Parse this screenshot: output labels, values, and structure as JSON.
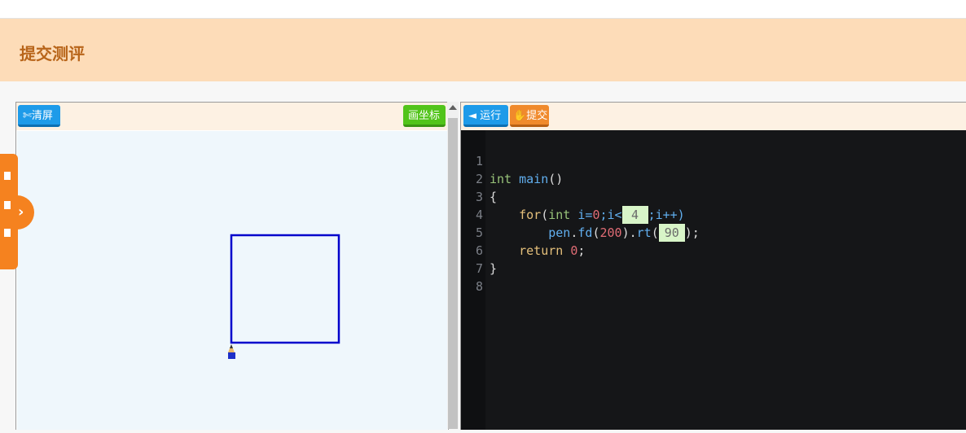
{
  "header": {
    "title": "提交测评"
  },
  "left_toolbar": {
    "clear_label": "清屏",
    "clear_icon": "scissors-icon",
    "coord_label": "画坐标"
  },
  "right_toolbar": {
    "run_label": "运行",
    "run_icon": "play-left-icon",
    "submit_label": "提交",
    "submit_icon": "hand-icon"
  },
  "drawing": {
    "shape": "square",
    "stroke_color": "#0000cc",
    "pen_icon": "pencil-icon"
  },
  "code": {
    "line_numbers": [
      "1",
      "2",
      "3",
      "4",
      "5",
      "6",
      "7",
      "8"
    ],
    "line1_type": "int",
    "line1_fn": "main",
    "line1_parens": "()",
    "line2": "{",
    "line3_for": "for",
    "line3_open": "(",
    "line3_int": "int",
    "line3_var": " i=",
    "line3_zero": "0",
    "line3_cond": ";i<",
    "blank1_value": "4",
    "line3_end": ";i++)",
    "line4_obj": "pen",
    "line4_dot1": ".",
    "line4_fd": "fd",
    "line4_open": "(",
    "line4_num": "200",
    "line4_close": ").",
    "line4_rt": "rt",
    "line4_open2": "(",
    "blank2_value": "90",
    "line4_end": ");",
    "line5_return": "return",
    "line5_zero": "0",
    "line5_semicolon": ";",
    "line6": "}"
  },
  "colors": {
    "header_bg": "#fddcb8",
    "header_text": "#b8651a",
    "editor_bg": "#151618",
    "accent_blue": "#1e9be9",
    "accent_green": "#52c41a",
    "accent_orange": "#f08a2c"
  }
}
